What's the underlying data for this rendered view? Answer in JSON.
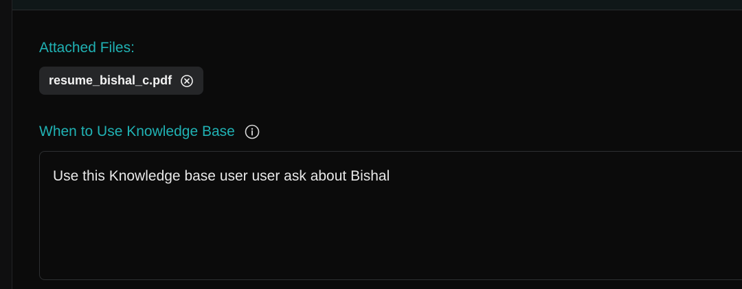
{
  "attached_files": {
    "label": "Attached Files:",
    "files": [
      {
        "name": "resume_bishal_c.pdf",
        "remove_icon": "close-circle-icon"
      }
    ]
  },
  "knowledge_base": {
    "label": "When to Use Knowledge Base",
    "info_icon": "info-icon",
    "usage_text": "Use this Knowledge base user user ask about Bishal"
  },
  "colors": {
    "accent": "#20b2b4",
    "background": "#0b0b0b",
    "chip": "#252628",
    "text": "#e8e8e8"
  }
}
